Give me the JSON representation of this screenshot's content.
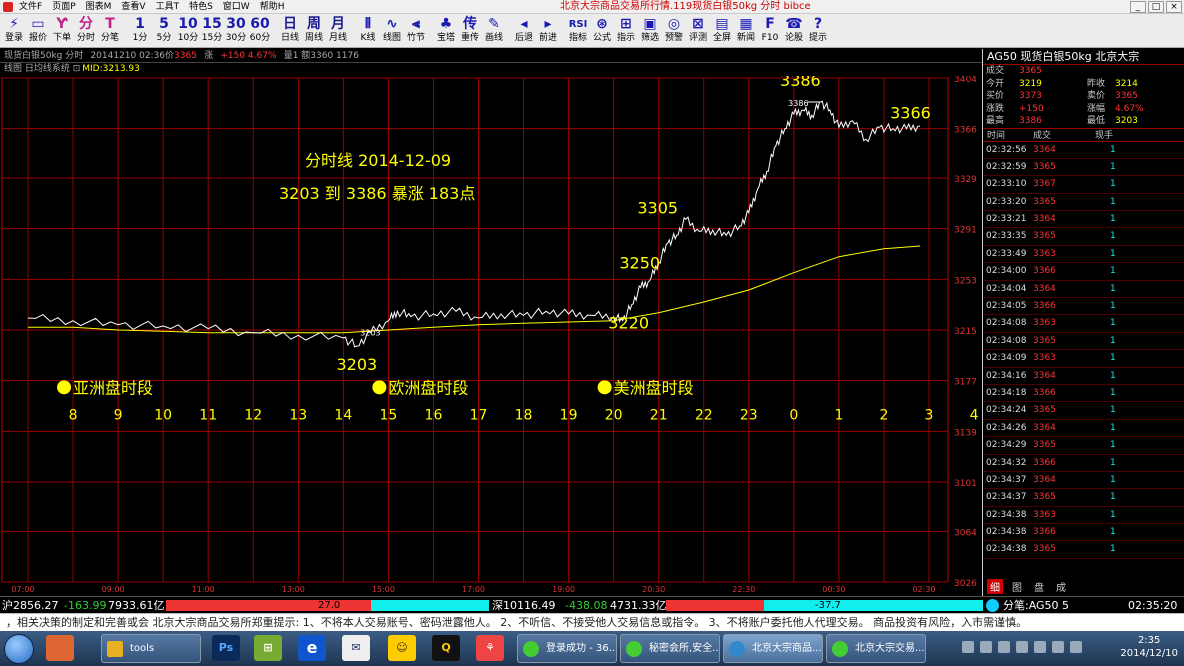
{
  "window": {
    "menus": [
      "文件F",
      "页面P",
      "图表M",
      "查看V",
      "工具T",
      "特色S",
      "窗口W",
      "帮助H"
    ],
    "title": "北京大宗商品交易所行情.119现货白银50kg 分时  bibce",
    "controls": [
      "_",
      "□",
      "×"
    ]
  },
  "toolbar": [
    {
      "glyph": "⚡",
      "label": "登录"
    },
    {
      "glyph": "▭",
      "label": "报价"
    },
    {
      "glyph": "Ƴ",
      "label": "下单"
    },
    {
      "glyph": "分",
      "label": "分时"
    },
    {
      "glyph": "T",
      "label": "分笔"
    },
    {
      "glyph": "1",
      "label": "1分"
    },
    {
      "glyph": "5",
      "label": "5分"
    },
    {
      "glyph": "10",
      "label": "10分"
    },
    {
      "glyph": "15",
      "label": "15分"
    },
    {
      "glyph": "30",
      "label": "30分"
    },
    {
      "glyph": "60",
      "label": "60分"
    },
    {
      "glyph": "日",
      "label": "日线"
    },
    {
      "glyph": "周",
      "label": "周线"
    },
    {
      "glyph": "月",
      "label": "月线"
    },
    {
      "glyph": "⫴",
      "label": "K线"
    },
    {
      "glyph": "∿",
      "label": "线图"
    },
    {
      "glyph": "⫷",
      "label": "竹节"
    },
    {
      "glyph": "♣",
      "label": "宝塔"
    },
    {
      "glyph": "传",
      "label": "重传"
    },
    {
      "glyph": "✎",
      "label": "画线"
    },
    {
      "glyph": "◂",
      "label": "后退"
    },
    {
      "glyph": "▸",
      "label": "前进"
    },
    {
      "glyph": "RSI",
      "label": "指标"
    },
    {
      "glyph": "⊛",
      "label": "公式"
    },
    {
      "glyph": "⊞",
      "label": "指示"
    },
    {
      "glyph": "▣",
      "label": "筛选"
    },
    {
      "glyph": "◎",
      "label": "预警"
    },
    {
      "glyph": "⊠",
      "label": "评测"
    },
    {
      "glyph": "▤",
      "label": "全屏"
    },
    {
      "glyph": "▦",
      "label": "新闻"
    },
    {
      "glyph": "F",
      "label": "F10"
    },
    {
      "glyph": "☎",
      "label": "论股"
    },
    {
      "glyph": "?",
      "label": "提示"
    }
  ],
  "infobar": {
    "name": "现货白银50kg 分时",
    "datetime": "20141210 02:36价",
    "price": "3365",
    "change_label": "涨",
    "change": "+150 4.67%",
    "volume": "量1 额3360 1176"
  },
  "indicator": {
    "text": "线图 日均线系统 ⊡",
    "mid": "MID:3213.93"
  },
  "chart_data": {
    "type": "line",
    "title": "分时线  2014-12-09",
    "subtitle": "3203  到  3386  暴涨  183点",
    "yticks": [
      "3404",
      "3366",
      "3329",
      "3291",
      "3253",
      "3215",
      "3177",
      "3139",
      "3101",
      "3064",
      "3026"
    ],
    "hours": [
      "8",
      "9",
      "10",
      "11",
      "12",
      "13",
      "14",
      "15",
      "16",
      "17",
      "18",
      "19",
      "20",
      "21",
      "22",
      "23",
      "0",
      "1",
      "2",
      "3",
      "4"
    ],
    "bottom_times": [
      "07:00",
      "09:00",
      "11:00",
      "13:00",
      "15:00",
      "17:00",
      "19:00",
      "20:30",
      "22:30",
      "00:30",
      "02:30"
    ],
    "sessions": [
      "亚洲盘时段",
      "欧洲盘时段",
      "美洲盘时段"
    ],
    "annotations": [
      {
        "label": "3203",
        "x": 14.3,
        "y": 3203
      },
      {
        "label": "3220",
        "x": 20.2,
        "y": 3222
      },
      {
        "label": "3250",
        "x": 20.8,
        "y": 3252
      },
      {
        "label": "3305",
        "x": 21.6,
        "y": 3298
      },
      {
        "label": "3386",
        "x": 24.5,
        "y": 3386
      },
      {
        "label": "3366",
        "x": 26.5,
        "y": 3366
      }
    ],
    "small_labels": [
      {
        "label": "3203",
        "x": 14.6,
        "y": 3214
      },
      {
        "label": "3386",
        "x": 24.1,
        "y": 3386
      }
    ],
    "price": [
      [
        7,
        3224
      ],
      [
        8,
        3222
      ],
      [
        9,
        3219
      ],
      [
        10,
        3218
      ],
      [
        11,
        3216
      ],
      [
        12,
        3213
      ],
      [
        13,
        3211
      ],
      [
        14,
        3209
      ],
      [
        14.3,
        3203
      ],
      [
        14.6,
        3213
      ],
      [
        15,
        3222
      ],
      [
        15.2,
        3229
      ],
      [
        15.5,
        3225
      ],
      [
        16,
        3227
      ],
      [
        16.5,
        3229
      ],
      [
        17,
        3224
      ],
      [
        17.5,
        3227
      ],
      [
        18,
        3226
      ],
      [
        18.5,
        3229
      ],
      [
        19,
        3227
      ],
      [
        19.5,
        3226
      ],
      [
        20,
        3225
      ],
      [
        20.2,
        3222
      ],
      [
        20.4,
        3234
      ],
      [
        20.6,
        3247
      ],
      [
        20.8,
        3252
      ],
      [
        21,
        3266
      ],
      [
        21.2,
        3280
      ],
      [
        21.4,
        3286
      ],
      [
        21.6,
        3298
      ],
      [
        21.9,
        3289
      ],
      [
        22.2,
        3290
      ],
      [
        22.5,
        3286
      ],
      [
        22.8,
        3293
      ],
      [
        23,
        3303
      ],
      [
        23.2,
        3321
      ],
      [
        23.4,
        3334
      ],
      [
        23.6,
        3353
      ],
      [
        23.8,
        3366
      ],
      [
        24,
        3377
      ],
      [
        24.2,
        3380
      ],
      [
        24.4,
        3376
      ],
      [
        24.6,
        3386
      ],
      [
        24.8,
        3380
      ],
      [
        25,
        3367
      ],
      [
        25.3,
        3372
      ],
      [
        25.6,
        3358
      ],
      [
        25.9,
        3367
      ],
      [
        26.2,
        3366
      ],
      [
        26.5,
        3366
      ],
      [
        26.8,
        3368
      ]
    ],
    "avg": [
      [
        7,
        3217
      ],
      [
        8,
        3217
      ],
      [
        9,
        3215
      ],
      [
        10,
        3214
      ],
      [
        11,
        3213
      ],
      [
        12,
        3213
      ],
      [
        13,
        3213
      ],
      [
        14,
        3213
      ],
      [
        15,
        3215
      ],
      [
        16,
        3217
      ],
      [
        17,
        3219
      ],
      [
        18,
        3220
      ],
      [
        19,
        3221
      ],
      [
        20,
        3222
      ],
      [
        21,
        3228
      ],
      [
        22,
        3236
      ],
      [
        23,
        3245
      ],
      [
        24,
        3258
      ],
      [
        25,
        3270
      ],
      [
        26,
        3276
      ],
      [
        26.8,
        3278
      ]
    ]
  },
  "quote": {
    "title": "AG50  现货白银50kg   北京大宗",
    "rows": [
      {
        "k1": "成交",
        "v1": "3365",
        "k2": "",
        "v2": ""
      },
      {
        "k1": "今开",
        "v1": "3219",
        "k2": "昨收",
        "v2": "3214"
      },
      {
        "k1": "买价",
        "v1": "3373",
        "k2": "卖价",
        "v2": "3365"
      },
      {
        "k1": "涨跌",
        "v1": "+150",
        "k2": "涨幅",
        "v2": "4.67%"
      },
      {
        "k1": "最高",
        "v1": "3386",
        "k2": "最低",
        "v2": "3203"
      }
    ],
    "tick_headers": [
      "时间",
      "成交",
      "现手"
    ],
    "ticks": [
      [
        "02:32:56",
        "3364",
        "1"
      ],
      [
        "02:32:59",
        "3365",
        "1"
      ],
      [
        "02:33:10",
        "3367",
        "1"
      ],
      [
        "02:33:20",
        "3365",
        "1"
      ],
      [
        "02:33:21",
        "3364",
        "1"
      ],
      [
        "02:33:35",
        "3365",
        "1"
      ],
      [
        "02:33:49",
        "3363",
        "1"
      ],
      [
        "02:34:00",
        "3366",
        "1"
      ],
      [
        "02:34:04",
        "3364",
        "1"
      ],
      [
        "02:34:05",
        "3366",
        "1"
      ],
      [
        "02:34:08",
        "3363",
        "1"
      ],
      [
        "02:34:08",
        "3365",
        "1"
      ],
      [
        "02:34:09",
        "3363",
        "1"
      ],
      [
        "02:34:16",
        "3364",
        "1"
      ],
      [
        "02:34:18",
        "3366",
        "1"
      ],
      [
        "02:34:24",
        "3365",
        "1"
      ],
      [
        "02:34:26",
        "3364",
        "1"
      ],
      [
        "02:34:29",
        "3365",
        "1"
      ],
      [
        "02:34:32",
        "3366",
        "1"
      ],
      [
        "02:34:37",
        "3364",
        "1"
      ],
      [
        "02:34:37",
        "3365",
        "1"
      ],
      [
        "02:34:38",
        "3363",
        "1"
      ],
      [
        "02:34:38",
        "3366",
        "1"
      ],
      [
        "02:34:38",
        "3365",
        "1"
      ]
    ],
    "tabs": [
      "细",
      "图",
      "盘",
      "成"
    ]
  },
  "indexbar": {
    "sh": "沪2856.27",
    "sh_chg": "-163.99",
    "sh_amt": "7933.61亿",
    "bar1": "27.0",
    "sz": "深10116.49",
    "sz_chg": "-438.08",
    "sz_amt": "4731.33亿",
    "bar2": "-37.7",
    "fenbi": "分笔:AG50 5",
    "time": "02:35:20"
  },
  "scroll_text": "，相关决策的制定和完善或会     北京大宗商品交易所郑重提示:   1、不将本人交易账号、密码泄露他人。   2、不听信、不接受他人交易信息或指令。   3、不将账户委托他人代理交易。   商品投资有风险，入市需谨慎。",
  "taskbar": {
    "items": [
      "tools",
      "登录成功 - 36...",
      "秘密会所,安全...",
      "北京大宗商品...",
      "北京大宗交易..."
    ],
    "quick": [
      "Ps",
      "⊞",
      "e",
      "✉",
      "☺",
      "Q",
      "⚘"
    ],
    "time": "2:35",
    "date": "2014/12/10"
  }
}
